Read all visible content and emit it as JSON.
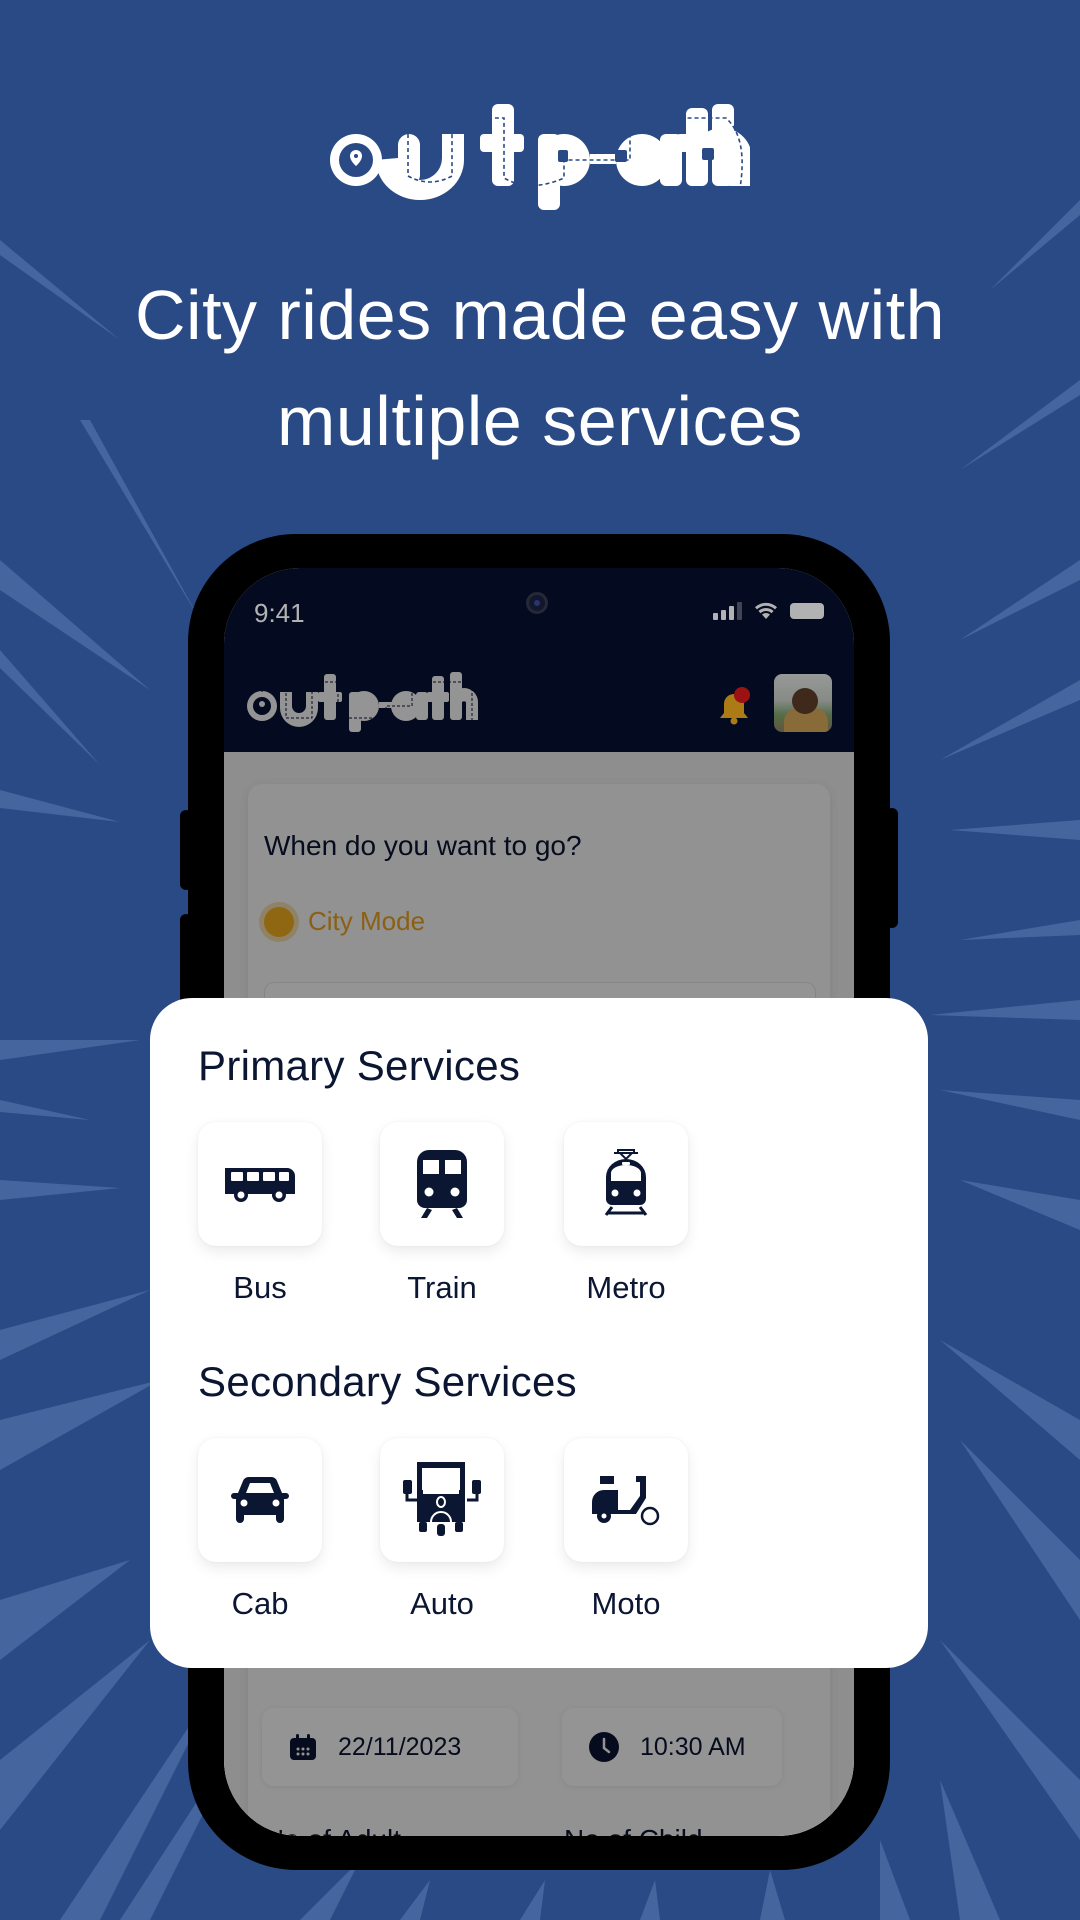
{
  "brand": {
    "name": "outpath"
  },
  "headline": {
    "line1": "City rides made easy with",
    "line2": "multiple services"
  },
  "colors": {
    "background": "#2a4a85",
    "app_header": "#07112e",
    "accent_yellow": "#f6b11f",
    "text_dark": "#0b1633",
    "notification_dot": "#e01b1b"
  },
  "phone": {
    "status_bar": {
      "time": "9:41",
      "icons": [
        "signal-icon",
        "wifi-icon",
        "battery-icon"
      ]
    },
    "app_header": {
      "logo": "outpath",
      "notification": {
        "icon": "bell-icon",
        "has_unread": true
      },
      "avatar": "profile-photo"
    },
    "trip_form": {
      "question": "When do you want to go?",
      "mode": {
        "label": "City Mode",
        "selected": true
      },
      "date": {
        "icon": "calendar-icon",
        "value": "22/11/2023"
      },
      "time": {
        "icon": "clock-icon",
        "value": "10:30 AM"
      },
      "adults_label": "No of Adult",
      "children_label": "No of Child"
    }
  },
  "services": {
    "primary": {
      "title": "Primary Services",
      "items": [
        {
          "label": "Bus",
          "icon": "bus-icon"
        },
        {
          "label": "Train",
          "icon": "train-icon"
        },
        {
          "label": "Metro",
          "icon": "metro-icon"
        }
      ]
    },
    "secondary": {
      "title": "Secondary Services",
      "items": [
        {
          "label": "Cab",
          "icon": "car-icon"
        },
        {
          "label": "Auto",
          "icon": "auto-rickshaw-icon"
        },
        {
          "label": "Moto",
          "icon": "scooter-icon"
        }
      ]
    }
  }
}
